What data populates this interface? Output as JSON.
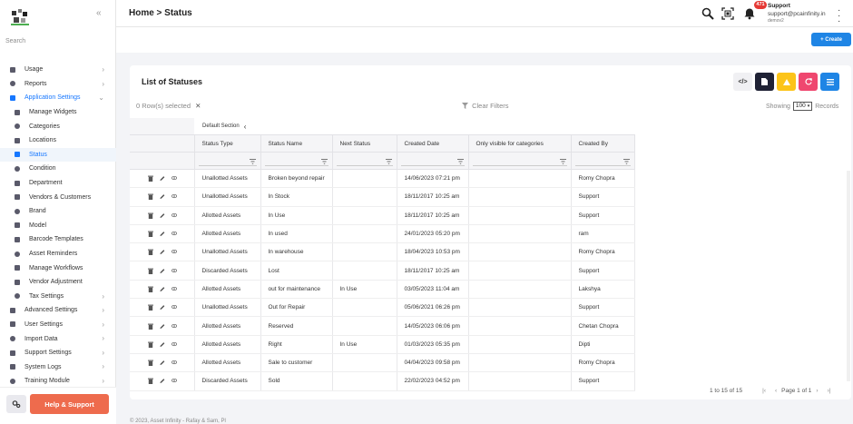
{
  "header": {
    "breadcrumb": "Home > Status",
    "notification_count": "471",
    "user_name": "Support",
    "user_email": "support@pcainfinity.in",
    "user_db": "demov2"
  },
  "sidebar": {
    "search_placeholder": "Search",
    "items": [
      {
        "label": "Usage",
        "icon": "bolt-icon",
        "level": 0,
        "chevron": true
      },
      {
        "label": "Reports",
        "icon": "document-icon",
        "level": 0,
        "chevron": true
      },
      {
        "label": "Application Settings",
        "icon": "wrench-icon",
        "level": 0,
        "chevron": true,
        "expanded": true
      },
      {
        "label": "Manage Widgets",
        "icon": "widgets-icon",
        "level": 1
      },
      {
        "label": "Categories",
        "icon": "categories-icon",
        "level": 1
      },
      {
        "label": "Locations",
        "icon": "location-pin-icon",
        "level": 1
      },
      {
        "label": "Status",
        "icon": "status-icon",
        "level": 1,
        "active": true
      },
      {
        "label": "Condition",
        "icon": "condition-icon",
        "level": 1
      },
      {
        "label": "Department",
        "icon": "department-icon",
        "level": 1
      },
      {
        "label": "Vendors & Customers",
        "icon": "people-icon",
        "level": 1
      },
      {
        "label": "Brand",
        "icon": "brand-icon",
        "level": 1
      },
      {
        "label": "Model",
        "icon": "model-icon",
        "level": 1
      },
      {
        "label": "Barcode Templates",
        "icon": "barcode-icon",
        "level": 1
      },
      {
        "label": "Asset Reminders",
        "icon": "bell-icon",
        "level": 1
      },
      {
        "label": "Manage Workflows",
        "icon": "workflow-icon",
        "level": 1
      },
      {
        "label": "Vendor Adjustment",
        "icon": "vendor-icon",
        "level": 1
      },
      {
        "label": "Tax Settings",
        "icon": "tax-icon",
        "level": 1,
        "chevron": true
      },
      {
        "label": "Advanced Settings",
        "icon": "gears-icon",
        "level": 0,
        "chevron": true
      },
      {
        "label": "User Settings",
        "icon": "user-settings-icon",
        "level": 0,
        "chevron": true
      },
      {
        "label": "Import Data",
        "icon": "import-icon",
        "level": 0,
        "chevron": true
      },
      {
        "label": "Support Settings",
        "icon": "support-icon",
        "level": 0,
        "chevron": true
      },
      {
        "label": "System Logs",
        "icon": "logs-icon",
        "level": 0,
        "chevron": true
      },
      {
        "label": "Training Module",
        "icon": "training-icon",
        "level": 0,
        "chevron": true
      }
    ],
    "help_button": "Help & Support"
  },
  "toolbar": {
    "create_label": "+ Create"
  },
  "card": {
    "title": "List of Statuses",
    "selected_text": "0 Row(s) selected",
    "clear_filters": "Clear Filters",
    "showing_label": "Showing",
    "page_size": "100",
    "records_label": "Records",
    "group_label": "Default Section",
    "columns": [
      "Status Type",
      "Status Name",
      "Next Status",
      "Created Date",
      "Only visible for categories",
      "Created By"
    ],
    "rows": [
      {
        "type": "Unallotted Assets",
        "name": "Broken beyond repair",
        "next": "",
        "date": "14/06/2023 07:21 pm",
        "only": "",
        "by": "Romy Chopra"
      },
      {
        "type": "Unallotted Assets",
        "name": "In Stock",
        "next": "",
        "date": "18/11/2017 10:25 am",
        "only": "",
        "by": "Support"
      },
      {
        "type": "Allotted Assets",
        "name": "In Use",
        "next": "",
        "date": "18/11/2017 10:25 am",
        "only": "",
        "by": "Support"
      },
      {
        "type": "Allotted Assets",
        "name": "In used",
        "next": "",
        "date": "24/01/2023 05:20 pm",
        "only": "",
        "by": "ram"
      },
      {
        "type": "Unallotted Assets",
        "name": "In warehouse",
        "next": "",
        "date": "18/04/2023 10:53 pm",
        "only": "",
        "by": "Romy Chopra"
      },
      {
        "type": "Discarded Assets",
        "name": "Lost",
        "next": "",
        "date": "18/11/2017 10:25 am",
        "only": "",
        "by": "Support"
      },
      {
        "type": "Allotted Assets",
        "name": "out for maintenance",
        "next": "In Use",
        "date": "03/05/2023 11:04 am",
        "only": "",
        "by": "Lakshya"
      },
      {
        "type": "Unallotted Assets",
        "name": "Out for Repair",
        "next": "",
        "date": "05/06/2021 06:26 pm",
        "only": "",
        "by": "Support"
      },
      {
        "type": "Allotted Assets",
        "name": "Reserved",
        "next": "",
        "date": "14/05/2023 06:06 pm",
        "only": "",
        "by": "Chetan Chopra"
      },
      {
        "type": "Allotted Assets",
        "name": "Right",
        "next": "In Use",
        "date": "01/03/2023 05:35 pm",
        "only": "",
        "by": "Dipti"
      },
      {
        "type": "Allotted Assets",
        "name": "Sale to customer",
        "next": "",
        "date": "04/04/2023 09:58 pm",
        "only": "",
        "by": "Romy Chopra"
      },
      {
        "type": "Discarded Assets",
        "name": "Sold",
        "next": "",
        "date": "22/02/2023 04:52 pm",
        "only": "",
        "by": "Support"
      }
    ],
    "pagination_text": "1 to 15 of 15",
    "page_text": "Page 1 of 1"
  },
  "footer": {
    "text": "© 2023, Asset Infinity - Rafay & Sam, Pl"
  },
  "colors": {
    "accent": "#1677ff",
    "create": "#1f85e5",
    "help": "#ee6b4d",
    "btn_dark": "#1f2235",
    "btn_yellow": "#fcc419",
    "btn_pink": "#ef476f",
    "btn_blue": "#1f85e5"
  }
}
